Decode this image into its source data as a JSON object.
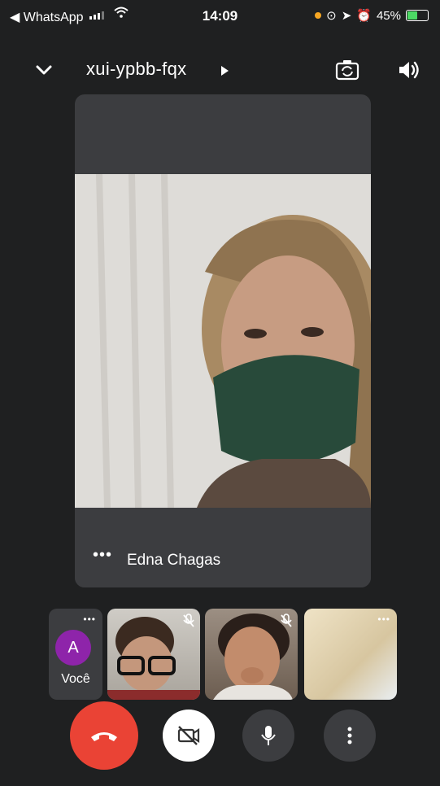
{
  "status_bar": {
    "back_app": "◀ WhatsApp",
    "time": "14:09",
    "battery": "45%"
  },
  "header": {
    "meeting_code": "xui-ypbb-fqx"
  },
  "main_tile": {
    "participant_name": "Edna Chagas",
    "more_label": "•••"
  },
  "thumbnails": {
    "self_initial": "A",
    "self_label": "Você",
    "more_label": "•••"
  },
  "colors": {
    "background": "#1f2021",
    "tile": "#3c3d40",
    "end_call": "#ea4335",
    "avatar": "#8e24aa"
  },
  "icons": [
    "chevron-down-icon",
    "play-arrow-icon",
    "switch-camera-icon",
    "speaker-icon",
    "mic-off-icon",
    "end-call-icon",
    "camera-off-icon",
    "mic-icon",
    "more-vert-icon"
  ]
}
